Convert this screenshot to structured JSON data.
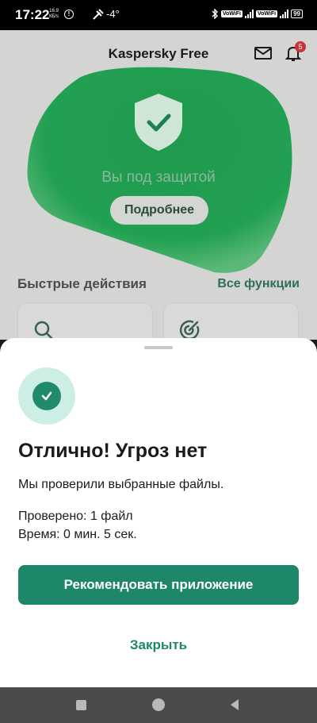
{
  "status_bar": {
    "time": "17:22",
    "net_speed_value": "16.9",
    "net_speed_unit": "КБ/s",
    "temperature": "-4°",
    "vowifi_1": "VoWiFi",
    "vowifi_2": "VoWiFi",
    "battery": "99",
    "icons": [
      "alert-circle-icon",
      "weather-icon",
      "bluetooth-icon",
      "signal-icon",
      "battery-icon"
    ]
  },
  "app": {
    "title": "Kaspersky Free",
    "notification_count": "5",
    "status_text": "Вы под защитой",
    "details_button": "Подробнее",
    "quick_actions_title": "Быстрые действия",
    "all_functions_link": "Все функции",
    "colors": {
      "accent": "#1e876a",
      "blob": "#1f9a4e"
    }
  },
  "sheet": {
    "title": "Отлично! Угроз нет",
    "description": "Мы проверили выбранные файлы.",
    "checked": "Проверено: 1 файл",
    "time": "Время: 0 мин. 5 сек.",
    "recommend_button": "Рекомендовать приложение",
    "close_button": "Закрыть"
  }
}
